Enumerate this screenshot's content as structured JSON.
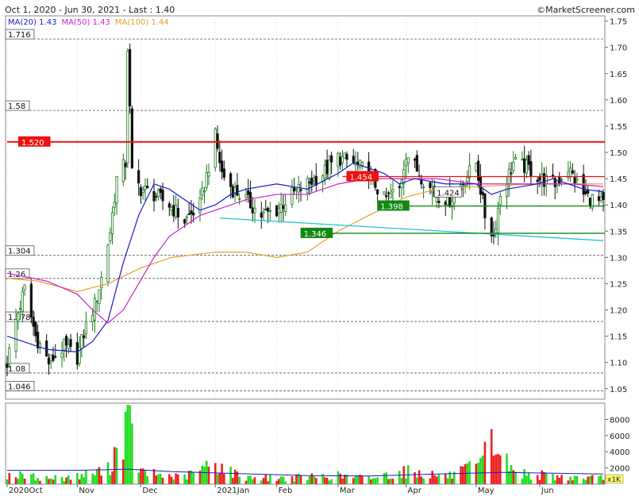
{
  "header": {
    "range_text": "Oct 1, 2020 - Jun 30, 2021 - Last : 1.40",
    "copyright": "©MarketScreener.com"
  },
  "legend": [
    {
      "name": "MA(20)",
      "value": "1.43",
      "color": "#1a1acc"
    },
    {
      "name": "MA(50)",
      "value": "1.43",
      "color": "#cc22cc"
    },
    {
      "name": "MA(100)",
      "value": "1.44",
      "color": "#e8a030"
    }
  ],
  "colors": {
    "up": "#1b7a1b",
    "down": "#111111",
    "vol_up": "#22dd22",
    "vol_down": "#ee2020",
    "resistance": "#ee1111",
    "support": "#118811",
    "trend": "#22c4d4",
    "vol_avg": "#1a1acc"
  },
  "chart_data": [
    {
      "type": "candlestick",
      "title": "",
      "ylim": [
        1.03,
        1.76
      ],
      "y_ticks": [
        "1.05",
        "1.10",
        "1.15",
        "1.20",
        "1.25",
        "1.30",
        "1.35",
        "1.40",
        "1.45",
        "1.50",
        "1.55",
        "1.60",
        "1.65",
        "1.70",
        "1.75"
      ],
      "x_ticks": [
        {
          "label": "2020Oct",
          "date": "2020-10-01"
        },
        {
          "label": "Nov",
          "date": "2020-11-02"
        },
        {
          "label": "Dec",
          "date": "2020-12-01"
        },
        {
          "label": "2021Jan",
          "date": "2021-01-04"
        },
        {
          "label": "Feb",
          "date": "2021-02-01"
        },
        {
          "label": "Mar",
          "date": "2021-03-01"
        },
        {
          "label": "Apr",
          "date": "2021-04-01"
        },
        {
          "label": "May",
          "date": "2021-05-03"
        },
        {
          "label": "Jun",
          "date": "2021-06-01"
        }
      ],
      "x_range": [
        "2020-10-01",
        "2021-06-30"
      ],
      "price_levels": [
        {
          "label": "1.716",
          "value": 1.716
        },
        {
          "label": "1.58",
          "value": 1.58
        },
        {
          "label": "1.304",
          "value": 1.304
        },
        {
          "label": "1.26",
          "value": 1.26
        },
        {
          "label": "1.178",
          "value": 1.178
        },
        {
          "label": "1.08",
          "value": 1.08
        },
        {
          "label": "1.046",
          "value": 1.046
        }
      ],
      "resistance_lines": [
        {
          "label": "1.520",
          "value": 1.52,
          "from": "2020-10-01",
          "style": "thick"
        },
        {
          "label": "1.454",
          "value": 1.454,
          "from": "2021-03-03",
          "style": "thin"
        }
      ],
      "support_lines": [
        {
          "label": "1.398",
          "value": 1.398,
          "from": "2021-03-29"
        },
        {
          "label": "1.346",
          "value": 1.346,
          "from": "2021-02-22"
        }
      ],
      "trend_line": {
        "from_date": "2021-01-06",
        "from_value": 1.375,
        "to_date": "2021-06-30",
        "to_value": 1.332
      },
      "annotations": [
        {
          "label": "1.424",
          "date": "2021-04-15",
          "value": 1.424
        }
      ],
      "ma20": [
        [
          "2020-10-01",
          1.15
        ],
        [
          "2020-10-19",
          1.125
        ],
        [
          "2020-11-02",
          1.12
        ],
        [
          "2020-11-09",
          1.14
        ],
        [
          "2020-11-16",
          1.18
        ],
        [
          "2020-11-23",
          1.29
        ],
        [
          "2020-11-30",
          1.38
        ],
        [
          "2020-12-07",
          1.44
        ],
        [
          "2020-12-14",
          1.43
        ],
        [
          "2020-12-21",
          1.41
        ],
        [
          "2020-12-28",
          1.39
        ],
        [
          "2021-01-04",
          1.4
        ],
        [
          "2021-01-11",
          1.42
        ],
        [
          "2021-01-18",
          1.43
        ],
        [
          "2021-02-01",
          1.44
        ],
        [
          "2021-02-15",
          1.43
        ],
        [
          "2021-03-01",
          1.46
        ],
        [
          "2021-03-08",
          1.48
        ],
        [
          "2021-03-15",
          1.47
        ],
        [
          "2021-03-22",
          1.46
        ],
        [
          "2021-03-29",
          1.44
        ],
        [
          "2021-04-05",
          1.45
        ],
        [
          "2021-04-19",
          1.44
        ],
        [
          "2021-05-03",
          1.44
        ],
        [
          "2021-05-10",
          1.42
        ],
        [
          "2021-05-17",
          1.43
        ],
        [
          "2021-05-31",
          1.44
        ],
        [
          "2021-06-07",
          1.45
        ],
        [
          "2021-06-14",
          1.44
        ],
        [
          "2021-06-21",
          1.43
        ],
        [
          "2021-06-30",
          1.425
        ]
      ],
      "ma50": [
        [
          "2020-10-01",
          1.27
        ],
        [
          "2020-10-19",
          1.255
        ],
        [
          "2020-11-02",
          1.23
        ],
        [
          "2020-11-09",
          1.2
        ],
        [
          "2020-11-16",
          1.175
        ],
        [
          "2020-11-23",
          1.2
        ],
        [
          "2020-11-30",
          1.25
        ],
        [
          "2020-12-07",
          1.3
        ],
        [
          "2020-12-14",
          1.34
        ],
        [
          "2020-12-21",
          1.36
        ],
        [
          "2020-12-28",
          1.38
        ],
        [
          "2021-01-04",
          1.39
        ],
        [
          "2021-01-18",
          1.41
        ],
        [
          "2021-02-01",
          1.42
        ],
        [
          "2021-02-15",
          1.42
        ],
        [
          "2021-03-01",
          1.44
        ],
        [
          "2021-03-15",
          1.45
        ],
        [
          "2021-04-01",
          1.45
        ],
        [
          "2021-04-15",
          1.45
        ],
        [
          "2021-05-03",
          1.44
        ],
        [
          "2021-05-17",
          1.44
        ],
        [
          "2021-06-01",
          1.44
        ],
        [
          "2021-06-15",
          1.44
        ],
        [
          "2021-06-30",
          1.435
        ]
      ],
      "ma100": [
        [
          "2020-10-01",
          1.26
        ],
        [
          "2020-10-15",
          1.255
        ],
        [
          "2020-11-02",
          1.235
        ],
        [
          "2020-11-16",
          1.25
        ],
        [
          "2020-12-01",
          1.28
        ],
        [
          "2020-12-15",
          1.3
        ],
        [
          "2021-01-04",
          1.31
        ],
        [
          "2021-01-18",
          1.31
        ],
        [
          "2021-02-01",
          1.3
        ],
        [
          "2021-02-15",
          1.31
        ],
        [
          "2021-03-01",
          1.35
        ],
        [
          "2021-03-15",
          1.38
        ],
        [
          "2021-04-01",
          1.415
        ],
        [
          "2021-04-15",
          1.43
        ],
        [
          "2021-05-03",
          1.435
        ],
        [
          "2021-06-01",
          1.44
        ],
        [
          "2021-06-30",
          1.44
        ]
      ],
      "ohlc_keypoints": [
        [
          "2020-10-01",
          1.1
        ],
        [
          "2020-10-05",
          1.18
        ],
        [
          "2020-10-09",
          1.24
        ],
        [
          "2020-10-14",
          1.15
        ],
        [
          "2020-10-20",
          1.1
        ],
        [
          "2020-10-27",
          1.13
        ],
        [
          "2020-11-02",
          1.11
        ],
        [
          "2020-11-06",
          1.17
        ],
        [
          "2020-11-10",
          1.21
        ],
        [
          "2020-11-13",
          1.26
        ],
        [
          "2020-11-17",
          1.35
        ],
        [
          "2020-11-20",
          1.45
        ],
        [
          "2020-11-24",
          1.48
        ],
        [
          "2020-11-25",
          1.7
        ],
        [
          "2020-11-27",
          1.46
        ],
        [
          "2020-12-01",
          1.43
        ],
        [
          "2020-12-07",
          1.42
        ],
        [
          "2020-12-14",
          1.4
        ],
        [
          "2020-12-21",
          1.37
        ],
        [
          "2020-12-28",
          1.4
        ],
        [
          "2021-01-04",
          1.53
        ],
        [
          "2021-01-07",
          1.46
        ],
        [
          "2021-01-12",
          1.43
        ],
        [
          "2021-01-18",
          1.41
        ],
        [
          "2021-01-25",
          1.38
        ],
        [
          "2021-02-01",
          1.39
        ],
        [
          "2021-02-08",
          1.42
        ],
        [
          "2021-02-15",
          1.44
        ],
        [
          "2021-02-22",
          1.46
        ],
        [
          "2021-03-01",
          1.49
        ],
        [
          "2021-03-08",
          1.48
        ],
        [
          "2021-03-15",
          1.46
        ],
        [
          "2021-03-22",
          1.41
        ],
        [
          "2021-03-29",
          1.43
        ],
        [
          "2021-04-01",
          1.5
        ],
        [
          "2021-04-07",
          1.46
        ],
        [
          "2021-04-14",
          1.42
        ],
        [
          "2021-04-21",
          1.41
        ],
        [
          "2021-04-28",
          1.45
        ],
        [
          "2021-05-03",
          1.48
        ],
        [
          "2021-05-07",
          1.38
        ],
        [
          "2021-05-11",
          1.34
        ],
        [
          "2021-05-14",
          1.42
        ],
        [
          "2021-05-20",
          1.48
        ],
        [
          "2021-05-27",
          1.47
        ],
        [
          "2021-06-01",
          1.45
        ],
        [
          "2021-06-08",
          1.44
        ],
        [
          "2021-06-14",
          1.47
        ],
        [
          "2021-06-21",
          1.42
        ],
        [
          "2021-06-30",
          1.4
        ]
      ]
    },
    {
      "type": "bar",
      "title": "",
      "ylim": [
        0,
        10000
      ],
      "y_ticks": [
        "2000",
        "4000",
        "6000",
        "8000"
      ],
      "unit_label": "x1K",
      "volume_avg": [
        [
          "2020-10-01",
          1700
        ],
        [
          "2020-11-02",
          1700
        ],
        [
          "2020-11-25",
          1850
        ],
        [
          "2020-12-15",
          1550
        ],
        [
          "2021-01-15",
          1300
        ],
        [
          "2021-02-15",
          1050
        ],
        [
          "2021-03-15",
          1000
        ],
        [
          "2021-04-15",
          1250
        ],
        [
          "2021-05-15",
          1450
        ],
        [
          "2021-06-30",
          1250
        ]
      ],
      "volume_keypoints": [
        [
          "2020-10-01",
          1500
        ],
        [
          "2020-10-20",
          900
        ],
        [
          "2020-11-02",
          1200
        ],
        [
          "2020-11-16",
          2200
        ],
        [
          "2020-11-25",
          9800
        ],
        [
          "2020-12-01",
          1800
        ],
        [
          "2020-12-20",
          1000
        ],
        [
          "2021-01-04",
          3200
        ],
        [
          "2021-01-15",
          1200
        ],
        [
          "2021-02-01",
          900
        ],
        [
          "2021-03-01",
          1300
        ],
        [
          "2021-03-15",
          900
        ],
        [
          "2021-04-01",
          2000
        ],
        [
          "2021-04-20",
          1200
        ],
        [
          "2021-05-05",
          2800
        ],
        [
          "2021-05-10",
          6800
        ],
        [
          "2021-05-20",
          1800
        ],
        [
          "2021-06-10",
          1100
        ],
        [
          "2021-06-30",
          900
        ]
      ]
    }
  ]
}
